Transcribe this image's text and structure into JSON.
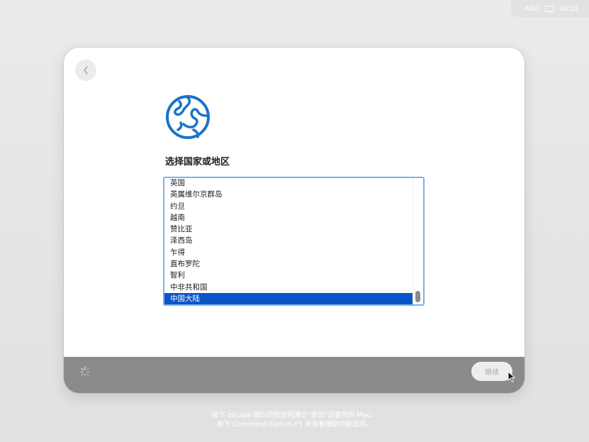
{
  "status": {
    "input_source": "ABC",
    "input_icon": "keyboard-icon",
    "time": "04:13"
  },
  "dialog": {
    "back_icon": "chevron-left-icon",
    "globe_icon": "globe-icon",
    "title": "选择国家或地区",
    "countries": [
      "英国",
      "英属维尔京群岛",
      "约旦",
      "越南",
      "赞比亚",
      "泽西岛",
      "乍得",
      "直布罗陀",
      "智利",
      "中非共和国",
      "中国大陆"
    ],
    "selected_country": "中国大陆",
    "continue_label": "继续",
    "spinner_icon": "spinner-icon"
  },
  "footer": {
    "hint_line1": "按下 escape 键以听取如何通过“旁白”设置你的 Mac。",
    "hint_line2": "按下 Command-Option-F5 来查看辅助功能选项。"
  },
  "colors": {
    "selection": "#0a55c9",
    "focus_ring": "#7db2ea",
    "globe": "#1a73c9",
    "bottom_bar": "#8b8b8b"
  }
}
